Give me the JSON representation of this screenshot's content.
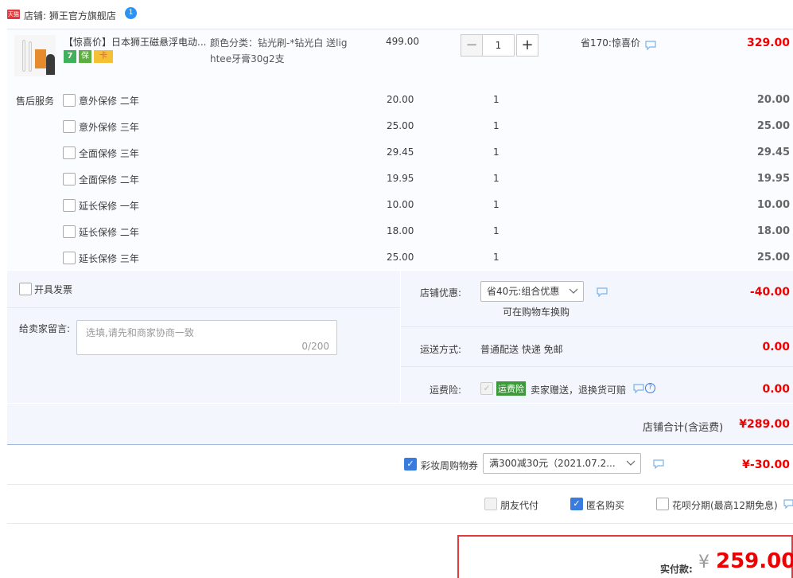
{
  "shop": {
    "badge": "天猫",
    "label": "店铺: 狮王官方旗舰店",
    "ww_icon": "1"
  },
  "item": {
    "title": "【惊喜价】日本狮王磁悬浮电动...",
    "badge_7": "7",
    "badge_ins": "保",
    "badge_card": "卡",
    "sku_line1": "颜色分类：钻光刷-*钻光白 送lig",
    "sku_line2": "htee牙膏30g2支",
    "price": "499.00",
    "qty_minus": "−",
    "qty": "1",
    "qty_plus": "+",
    "promo": "省170:惊喜价",
    "subtotal": "329.00"
  },
  "services": {
    "label": "售后服务",
    "rows": [
      {
        "name": "意外保修 二年",
        "price": "20.00",
        "qty": "1",
        "subtotal": "20.00"
      },
      {
        "name": "意外保修 三年",
        "price": "25.00",
        "qty": "1",
        "subtotal": "25.00"
      },
      {
        "name": "全面保修 三年",
        "price": "29.45",
        "qty": "1",
        "subtotal": "29.45"
      },
      {
        "name": "全面保修 二年",
        "price": "19.95",
        "qty": "1",
        "subtotal": "19.95"
      },
      {
        "name": "延长保修 一年",
        "price": "10.00",
        "qty": "1",
        "subtotal": "10.00"
      },
      {
        "name": "延长保修 二年",
        "price": "18.00",
        "qty": "1",
        "subtotal": "18.00"
      },
      {
        "name": "延长保修 三年",
        "price": "25.00",
        "qty": "1",
        "subtotal": "25.00"
      }
    ]
  },
  "invoice": {
    "label": "开具发票"
  },
  "message": {
    "label": "给卖家留言:",
    "placeholder": "选填,请先和商家协商一致",
    "counter": "0/200"
  },
  "shop_discount": {
    "label": "店铺优惠:",
    "selected": "省40元:组合优惠",
    "note": "可在购物车换购",
    "amount": "-40.00"
  },
  "shipping": {
    "label": "运送方式:",
    "value": "普通配送 快递 免邮",
    "amount": "0.00"
  },
  "freight_ins": {
    "label": "运费险:",
    "badge": "运费险",
    "text": "卖家赠送，退换货可赔",
    "help": "?",
    "amount": "0.00"
  },
  "shop_total": {
    "label": "店铺合计(含运费)",
    "amount": "¥289.00"
  },
  "coupon": {
    "label": "彩妆周购物券",
    "selected": "满300减30元（2021.07.2...",
    "amount": "¥-30.00"
  },
  "options": {
    "friend_pay": "朋友代付",
    "anonymous": "匿名购买",
    "huabei": "花呗分期(最高12期免息)"
  },
  "pay": {
    "label": "实付款:",
    "currency": "¥",
    "amount": "259.00"
  },
  "colors": {
    "accent_red": "#e4393c",
    "price_red": "#ee0000",
    "checkbox_blue": "#3a7be0",
    "panel_bg": "#f3f6fc"
  }
}
